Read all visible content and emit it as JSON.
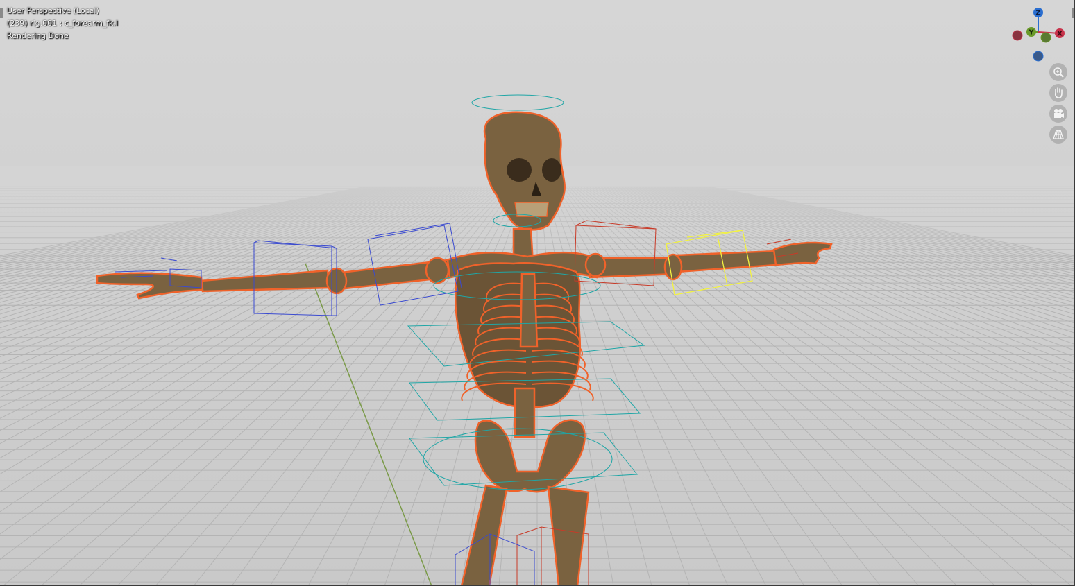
{
  "viewport": {
    "view_label": "User Perspective (Local)",
    "object_label": "(239) rig.001 : c_forearm_fk.l",
    "status_label": "Rendering Done"
  },
  "gizmo": {
    "z_label": "Z",
    "y_label": "Y",
    "x_label": "X",
    "x_color": "#c8324a",
    "y_color": "#6a9a2a",
    "z_color": "#2a6ed0"
  },
  "nav_buttons": [
    {
      "icon": "zoom-icon"
    },
    {
      "icon": "pan-hand-icon"
    },
    {
      "icon": "camera-icon"
    },
    {
      "icon": "perspective-grid-icon"
    }
  ],
  "colors": {
    "bone": "#7a6240",
    "selection_outline": "#f0622a",
    "ik_widget": "#3a4ad0",
    "fk_widget": "#c83a28",
    "active_widget": "#f2f240",
    "torso_widget": "#1fa6a6"
  }
}
